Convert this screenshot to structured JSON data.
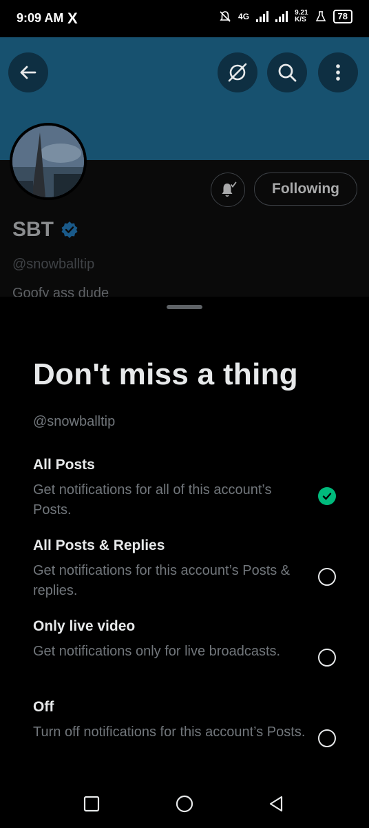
{
  "status_bar": {
    "time": "9:09 AM",
    "app_icon": "X",
    "network_type": "4G",
    "speed_value": "9.21",
    "speed_unit": "K/S",
    "battery": "78"
  },
  "header": {
    "back_icon": "arrow-left-icon",
    "mute_icon": "circle-slash-icon",
    "search_icon": "search-icon",
    "more_icon": "more-vertical-icon"
  },
  "profile": {
    "name": "SBT",
    "handle": "@snowballtip",
    "bio": "Goofy ass dude",
    "following_label": "Following"
  },
  "sheet": {
    "title": "Don't miss a thing",
    "handle": "@snowballtip",
    "options": [
      {
        "title": "All Posts",
        "desc": "Get notifications for all of this account’s Posts.",
        "selected": true
      },
      {
        "title": "All Posts & Replies",
        "desc": "Get notifications for this account’s Posts & replies.",
        "selected": false
      },
      {
        "title": "Only live video",
        "desc": "Get notifications only for live broadcasts.",
        "selected": false
      },
      {
        "title": "Off",
        "desc": "Turn off notifications for this account’s Posts.",
        "selected": false
      }
    ]
  },
  "colors": {
    "banner": "#17516f",
    "accent_green": "#00ba7c",
    "verified_blue": "#1d9bf0"
  }
}
